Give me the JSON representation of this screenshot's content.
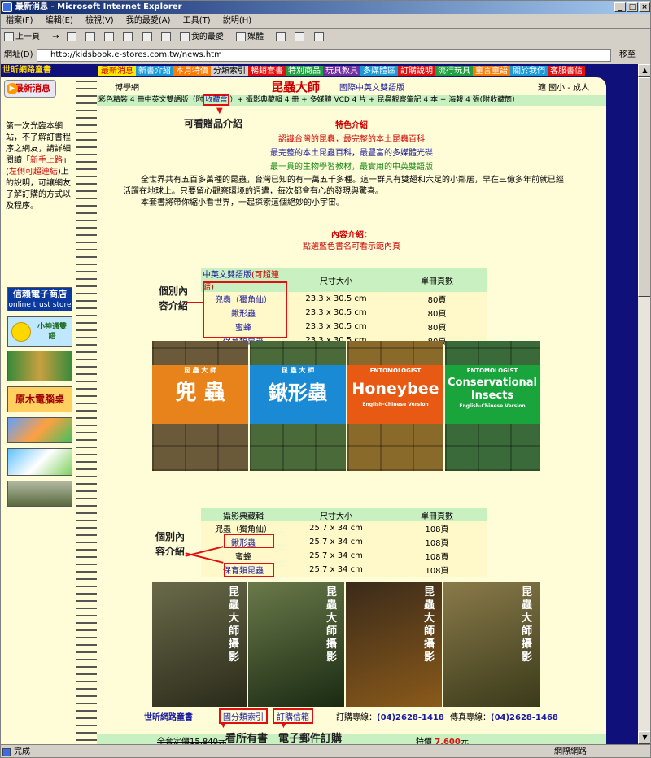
{
  "window": {
    "title": "最新消息 - Microsoft Internet Explorer",
    "min": "_",
    "max": "□",
    "close": "×"
  },
  "menu": [
    "檔案(F)",
    "編輯(E)",
    "檢視(V)",
    "我的最愛(A)",
    "工具(T)",
    "說明(H)"
  ],
  "toolbar": {
    "back": "上一頁",
    "forward": "→",
    "favorites": "我的最愛",
    "media": "媒體"
  },
  "address": {
    "label": "網址(D)",
    "url": "http://kidsbook.e-stores.com.tw/news.htm",
    "go": "移至"
  },
  "status": {
    "text": "完成",
    "zone": "網際網路"
  },
  "site": {
    "logo": "世昕網路童書",
    "nav": [
      "最新消息",
      "新書介紹",
      "本月特價",
      "分類索引",
      "暢銷套書",
      "特別商品",
      "玩具教具",
      "多媒體區",
      "訂購說明",
      "流行玩具",
      "童言童語",
      "關於我們",
      "客服書信"
    ]
  },
  "sidebar": {
    "badge": "最新消息",
    "text1": "第一次光臨本網站，不了解訂書程序之網友，請詳細閱讀「",
    "link1": "新手上路",
    "text2": "」(",
    "link2": "左側可超連結",
    "text3": ")上的說明，可讓網友了解訂購的方式以及程序。",
    "trust_title": "信賴電子商店",
    "trust_sub": "online trust store",
    "banner1": "小神通雙語",
    "banner2": "原木電腦桌"
  },
  "header": {
    "left": "博學網",
    "title": "昆蟲大師",
    "subtitle": "國際中英文雙語版",
    "right": "適 國小 - 成人"
  },
  "pkg": {
    "pre": "彩色精裝 4 冊中英文雙語版（附",
    "link": "收藏盒",
    "post": "）+ 攝影典藏輯 4 冊 + 多媒體 VCD 4 片 + 昆蟲觀察筆記 4 本 + 海報 4 張(附收藏筒）"
  },
  "gift_note": "可看贈品介紹",
  "features": {
    "title": "特色介紹",
    "l1": "認識台灣的昆蟲，最完整的本土昆蟲百科",
    "l2": "最完整的本土昆蟲百科，最豐富的多媒體光碟",
    "l3": "最一貫的生物學習教材，最實用的中英雙語版"
  },
  "intro": {
    "p1": "全世界共有五百多萬種的昆蟲，台灣已知的有一萬五千多種。這一群具有雙翅和六足的小鄰居，早在三億多年前就已經活躍在地球上。只要留心觀察環境的週遭，每次都會有心的發現與驚喜。",
    "p2": "本套書將帶你縮小看世界，一起探索這個絕妙的小宇宙。"
  },
  "content_intro": {
    "title": "內容介紹：",
    "text": "點選藍色書名可看示範內頁"
  },
  "individual_note": "個別內容介紹",
  "table1": {
    "headers": [
      "中英文雙語版",
      "(可超連結)",
      "尺寸大小",
      "單冊頁數"
    ],
    "rows": [
      [
        "兜蟲（獨角仙）",
        "23.3 x 30.5 cm",
        "80頁"
      ],
      [
        "鍬形蟲",
        "23.3 x 30.5 cm",
        "80頁"
      ],
      [
        "蜜蜂",
        "23.3 x 30.5 cm",
        "80頁"
      ],
      [
        "保育類昆蟲",
        "23.3 x 30.5 cm",
        "80頁"
      ]
    ]
  },
  "covers1": [
    {
      "title": "兜 蟲",
      "top": "昆 蟲 大 師",
      "color": "#e8821a"
    },
    {
      "title": "鍬形蟲",
      "top": "昆 蟲 大 師",
      "color": "#1a8ad4"
    },
    {
      "title": "Honeybee",
      "top": "ENTOMOLOGIST",
      "color": "#e85a14",
      "sub": "English-Chinese Version"
    },
    {
      "title": "Conservational Insects",
      "top": "ENTOMOLOGIST",
      "color": "#1aa43c",
      "sub": "English-Chinese Version"
    }
  ],
  "table2": {
    "headers": [
      "攝影典藏輯",
      "尺寸大小",
      "單冊頁數"
    ],
    "rows": [
      [
        "兜蟲（獨角仙）",
        "25.7 x 34 cm",
        "108頁"
      ],
      [
        "鍬形蟲",
        "25.7 x 34 cm",
        "108頁"
      ],
      [
        "蜜蜂",
        "25.7 x 34 cm",
        "108頁"
      ],
      [
        "保育類昆蟲",
        "25.7 x 34 cm",
        "108頁"
      ]
    ]
  },
  "covers2": [
    {
      "title": "昆蟲大師攝影",
      "sub": "典藏版",
      "color": "#3a3a2a"
    },
    {
      "title": "昆蟲大師攝影",
      "sub": "典藏版",
      "color": "#2e3a22"
    },
    {
      "title": "昆蟲大師攝影",
      "sub": "典藏版",
      "color": "#201a14"
    },
    {
      "title": "昆蟲大師攝影",
      "sub": "典藏版",
      "color": "#5a4a2e"
    }
  ],
  "footer": {
    "site": "世昕網路童書",
    "cat_index": "國分類索引",
    "order_mail": "訂購信箱",
    "phone_label": "訂購專線：",
    "phone": "(04)2628-1418",
    "fax_label": "傳真專線：",
    "fax": "(04)2628-1468",
    "orig_price": "全套定價15,840元",
    "hand_note": "看所有書　電子郵件訂購",
    "special_label": "特價",
    "special_price": "7,600",
    "yuan": "元"
  }
}
